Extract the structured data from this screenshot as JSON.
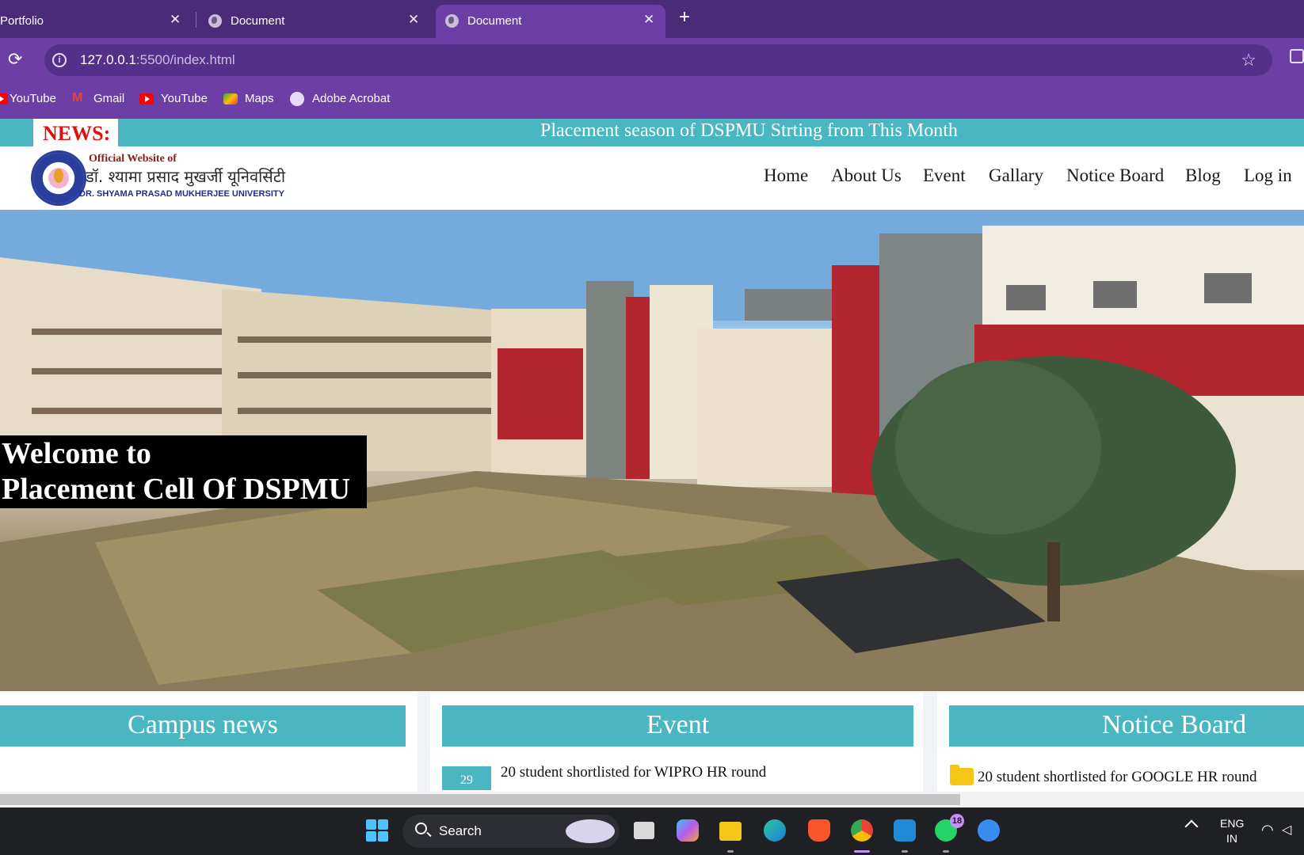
{
  "browser": {
    "tabs": [
      {
        "title": "Portfolio",
        "close": "✕",
        "active": false
      },
      {
        "title": "Document",
        "close": "✕",
        "active": false
      },
      {
        "title": "Document",
        "close": "✕",
        "active": true
      }
    ],
    "new_tab": "+",
    "url_host": "127.0.0.1",
    "url_path": ":5500/index.html",
    "bookmarks": [
      "YouTube",
      "Gmail",
      "YouTube",
      "Maps",
      "Adobe Acrobat"
    ]
  },
  "site": {
    "news_label": "NEWS:",
    "news_text": "Placement season of DSPMU Strting from This Month",
    "logo": {
      "official": "Official Website of",
      "hindi": "डॉ. श्यामा प्रसाद मुखर्जी यूनिवर्सिटी",
      "english": "DR. SHYAMA PRASAD MUKHERJEE UNIVERSITY"
    },
    "nav": [
      "Home",
      "About Us",
      "Event",
      "Gallary",
      "Notice Board",
      "Blog",
      "Log in"
    ],
    "hero": {
      "line1": "Welcome to",
      "line2": "Placement Cell Of DSPMU"
    },
    "cards": {
      "campus_news": {
        "title": "Campus news"
      },
      "event": {
        "title": "Event",
        "date": "29",
        "item": "20 student shortlisted for WIPRO HR round"
      },
      "notice_board": {
        "title": "Notice Board",
        "item": "20 student shortlisted for GOOGLE HR round"
      }
    }
  },
  "taskbar": {
    "search_label": "Search",
    "whatsapp_badge": "18",
    "language": "ENG",
    "region": "IN"
  },
  "colors": {
    "accent_teal": "#49b6c2",
    "browser_purple": "#6d3fa6",
    "news_red": "#e01010"
  }
}
